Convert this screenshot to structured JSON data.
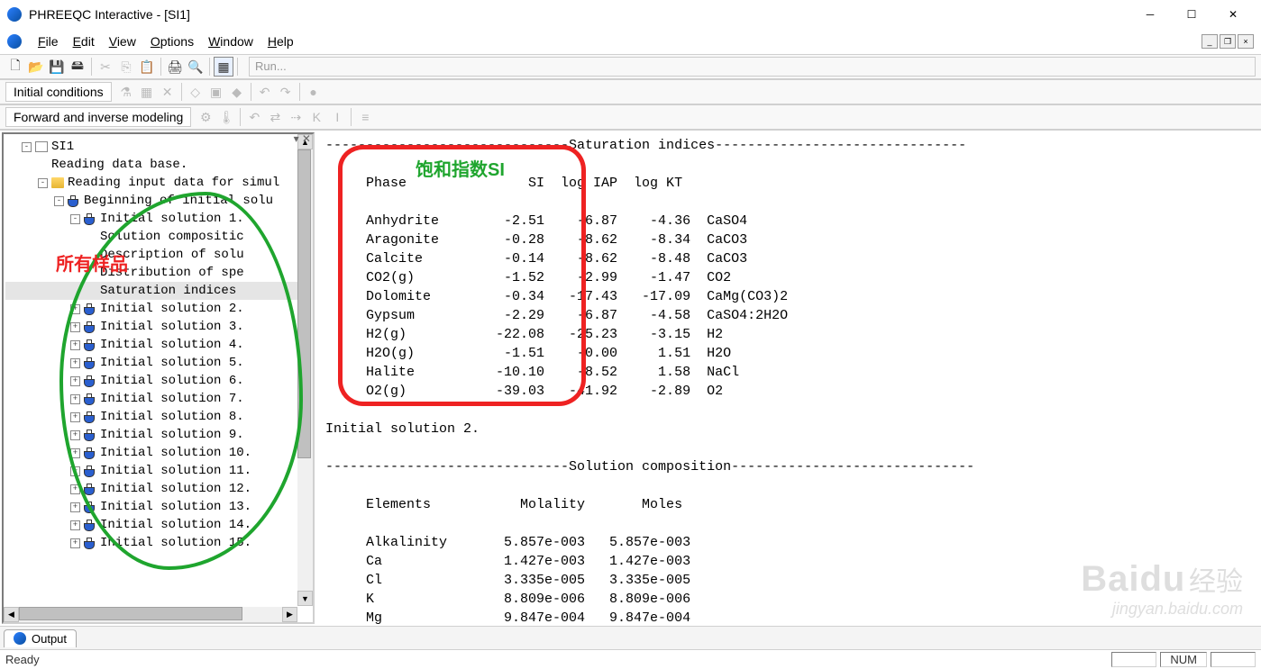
{
  "title": "PHREEQC Interactive - [SI1]",
  "menu": [
    "File",
    "Edit",
    "View",
    "Options",
    "Window",
    "Help"
  ],
  "run_placeholder": "Run...",
  "toolbar_labels": {
    "initial": "Initial conditions",
    "modeling": "Forward and inverse modeling"
  },
  "tree": {
    "root": "SI1",
    "items": [
      {
        "depth": 1,
        "exp": "-",
        "icon": "doc",
        "label": "SI1"
      },
      {
        "depth": 2,
        "exp": "",
        "icon": "",
        "label": "Reading data base."
      },
      {
        "depth": 2,
        "exp": "-",
        "icon": "folder",
        "label": "Reading input data for simul"
      },
      {
        "depth": 3,
        "exp": "-",
        "icon": "flask",
        "label": "Beginning of initial solu"
      },
      {
        "depth": 4,
        "exp": "-",
        "icon": "flask",
        "label": "Initial solution 1."
      },
      {
        "depth": 5,
        "exp": "",
        "icon": "",
        "label": "Solution compositic"
      },
      {
        "depth": 5,
        "exp": "",
        "icon": "",
        "label": "Description of solu"
      },
      {
        "depth": 5,
        "exp": "",
        "icon": "",
        "label": "Distribution of spe"
      },
      {
        "depth": 5,
        "exp": "",
        "icon": "",
        "label": "Saturation indices",
        "selected": true
      },
      {
        "depth": 4,
        "exp": "+",
        "icon": "flask",
        "label": "Initial solution 2."
      },
      {
        "depth": 4,
        "exp": "+",
        "icon": "flask",
        "label": "Initial solution 3."
      },
      {
        "depth": 4,
        "exp": "+",
        "icon": "flask",
        "label": "Initial solution 4."
      },
      {
        "depth": 4,
        "exp": "+",
        "icon": "flask",
        "label": "Initial solution 5."
      },
      {
        "depth": 4,
        "exp": "+",
        "icon": "flask",
        "label": "Initial solution 6."
      },
      {
        "depth": 4,
        "exp": "+",
        "icon": "flask",
        "label": "Initial solution 7."
      },
      {
        "depth": 4,
        "exp": "+",
        "icon": "flask",
        "label": "Initial solution 8."
      },
      {
        "depth": 4,
        "exp": "+",
        "icon": "flask",
        "label": "Initial solution 9."
      },
      {
        "depth": 4,
        "exp": "+",
        "icon": "flask",
        "label": "Initial solution 10."
      },
      {
        "depth": 4,
        "exp": "+",
        "icon": "flask",
        "label": "Initial solution 11."
      },
      {
        "depth": 4,
        "exp": "+",
        "icon": "flask",
        "label": "Initial solution 12."
      },
      {
        "depth": 4,
        "exp": "+",
        "icon": "flask",
        "label": "Initial solution 13."
      },
      {
        "depth": 4,
        "exp": "+",
        "icon": "flask",
        "label": "Initial solution 14."
      },
      {
        "depth": 4,
        "exp": "+",
        "icon": "flask",
        "label": "Initial solution 15."
      }
    ]
  },
  "output": {
    "sat_header": "------------------------------Saturation indices-------------------------------",
    "col_header": "     Phase               SI  log IAP  log KT",
    "rows": [
      {
        "phase": "Anhydrite",
        "si": "-2.51",
        "iap": "-6.87",
        "kt": "-4.36",
        "formula": "CaSO4"
      },
      {
        "phase": "Aragonite",
        "si": "-0.28",
        "iap": "-8.62",
        "kt": "-8.34",
        "formula": "CaCO3"
      },
      {
        "phase": "Calcite",
        "si": "-0.14",
        "iap": "-8.62",
        "kt": "-8.48",
        "formula": "CaCO3"
      },
      {
        "phase": "CO2(g)",
        "si": "-1.52",
        "iap": "-2.99",
        "kt": "-1.47",
        "formula": "CO2"
      },
      {
        "phase": "Dolomite",
        "si": "-0.34",
        "iap": "-17.43",
        "kt": "-17.09",
        "formula": "CaMg(CO3)2"
      },
      {
        "phase": "Gypsum",
        "si": "-2.29",
        "iap": "-6.87",
        "kt": "-4.58",
        "formula": "CaSO4:2H2O"
      },
      {
        "phase": "H2(g)",
        "si": "-22.08",
        "iap": "-25.23",
        "kt": "-3.15",
        "formula": "H2"
      },
      {
        "phase": "H2O(g)",
        "si": "-1.51",
        "iap": "-0.00",
        "kt": "1.51",
        "formula": "H2O"
      },
      {
        "phase": "Halite",
        "si": "-10.10",
        "iap": "-8.52",
        "kt": "1.58",
        "formula": "NaCl"
      },
      {
        "phase": "O2(g)",
        "si": "-39.03",
        "iap": "-41.92",
        "kt": "-2.89",
        "formula": "O2"
      }
    ],
    "init2": "Initial solution 2.",
    "comp_header": "------------------------------Solution composition------------------------------",
    "comp_cols": "     Elements           Molality       Moles",
    "comp_rows": [
      {
        "el": "Alkalinity",
        "mol": "5.857e-003",
        "moles": "5.857e-003"
      },
      {
        "el": "Ca",
        "mol": "1.427e-003",
        "moles": "1.427e-003"
      },
      {
        "el": "Cl",
        "mol": "3.335e-005",
        "moles": "3.335e-005"
      },
      {
        "el": "K",
        "mol": "8.809e-006",
        "moles": "8.809e-006"
      },
      {
        "el": "Mg",
        "mol": "9.847e-004",
        "moles": "9.847e-004"
      }
    ]
  },
  "annotations": {
    "all_samples": "所有样品",
    "si_label": "饱和指数SI"
  },
  "tab": "Output",
  "status": "Ready",
  "status_right": [
    "",
    "NUM",
    ""
  ],
  "watermark": {
    "brand": "Baidu",
    "cn": "经验",
    "url": "jingyan.baidu.com"
  }
}
